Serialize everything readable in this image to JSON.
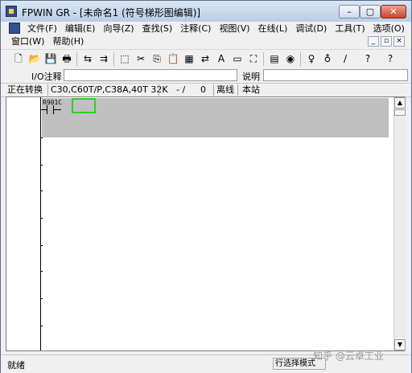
{
  "window": {
    "title": "FPWIN GR - [未命名1 (符号梯形图编辑)]",
    "caption_buttons": {
      "minimize": "–",
      "maximize": "▢",
      "close": "✕"
    }
  },
  "menu": {
    "row1": [
      "文件(F)",
      "编辑(E)",
      "向导(Z)",
      "查找(S)",
      "注释(C)",
      "视图(V)",
      "在线(L)",
      "调试(D)",
      "工具(T)",
      "选项(O)"
    ],
    "row2": [
      "窗口(W)",
      "帮助(H)"
    ],
    "mdi_buttons": [
      "_",
      "▫",
      "×"
    ]
  },
  "toolbar": {
    "icons": [
      "new-icon",
      "open-icon",
      "save-icon",
      "print-icon",
      "convert-icon",
      "convert-all-icon",
      "select-icon",
      "cut-icon",
      "copy-icon",
      "paste-icon",
      "block-icon",
      "replace-icon",
      "text-icon",
      "comment-icon",
      "find-icon",
      "monitor-icon",
      "record-icon",
      "tool1-icon",
      "tool2-icon",
      "tool3-icon",
      "tool4-icon",
      "help-icon"
    ],
    "glyphs": [
      "🗋",
      "📂",
      "💾",
      "🖶",
      "⇆",
      "⇉",
      "⬚",
      "✂",
      "⎘",
      "📋",
      "▦",
      "⇄",
      "A",
      "▭",
      "⛶",
      "▤",
      "◉",
      "♀",
      "♁",
      "∕",
      "?",
      "?"
    ]
  },
  "io_bar": {
    "io_label": "I/O注释",
    "io_value": "",
    "desc_label": "说明",
    "desc_value": ""
  },
  "status_top": {
    "state": "正在转换",
    "model": "C30,C60T/P,C38A,40T 32K",
    "position": "- /",
    "count": "0",
    "online": "离线",
    "station": "本站"
  },
  "ladder": {
    "contact_label": "R901C"
  },
  "statusbar": {
    "left": "就绪",
    "mode": "行选择模式"
  },
  "watermark": "知乎 @云卓工业",
  "colors": {
    "title_bg": "#c9d9ee",
    "highlight": "#c0c0c0",
    "cursor": "#2ad02a"
  }
}
